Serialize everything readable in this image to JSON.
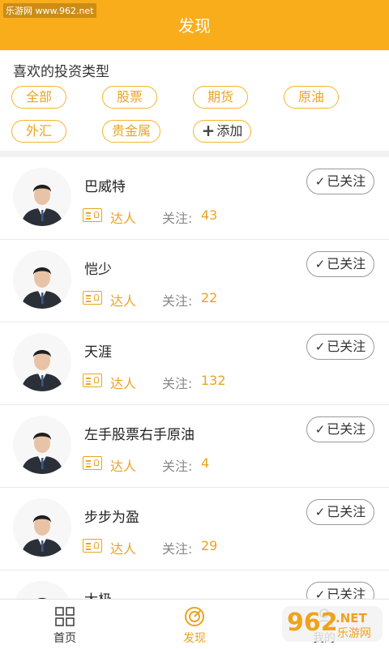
{
  "watermark": "乐游网 www.962.net",
  "header": {
    "title": "发现"
  },
  "section": {
    "title": "喜欢的投资类型"
  },
  "tags": [
    {
      "label": "全部"
    },
    {
      "label": "股票"
    },
    {
      "label": "期货"
    },
    {
      "label": "原油"
    },
    {
      "label": "外汇"
    },
    {
      "label": "贵金属"
    }
  ],
  "add_tag": {
    "label": "添加",
    "icon": "plus-icon"
  },
  "list": {
    "role_label": "达人",
    "fans_label": "关注:",
    "follow_label": "已关注",
    "items": [
      {
        "name": "巴威特",
        "fans": "43"
      },
      {
        "name": "恺少",
        "fans": "22"
      },
      {
        "name": "天涯",
        "fans": "132"
      },
      {
        "name": "左手股票右手原油",
        "fans": "4"
      },
      {
        "name": "步步为盈",
        "fans": "29"
      },
      {
        "name": "太极",
        "fans": ""
      }
    ]
  },
  "tabbar": {
    "items": [
      {
        "label": "首页",
        "icon": "grid-icon"
      },
      {
        "label": "发现",
        "icon": "compass-icon"
      },
      {
        "label": "我的",
        "icon": "user-icon"
      }
    ]
  },
  "colors": {
    "accent": "#f9ad1b",
    "tag_text": "#e9a420"
  },
  "logo_watermark": {
    "text_top": "962",
    "text_mid": ".NET",
    "text_bottom": "乐游网"
  }
}
